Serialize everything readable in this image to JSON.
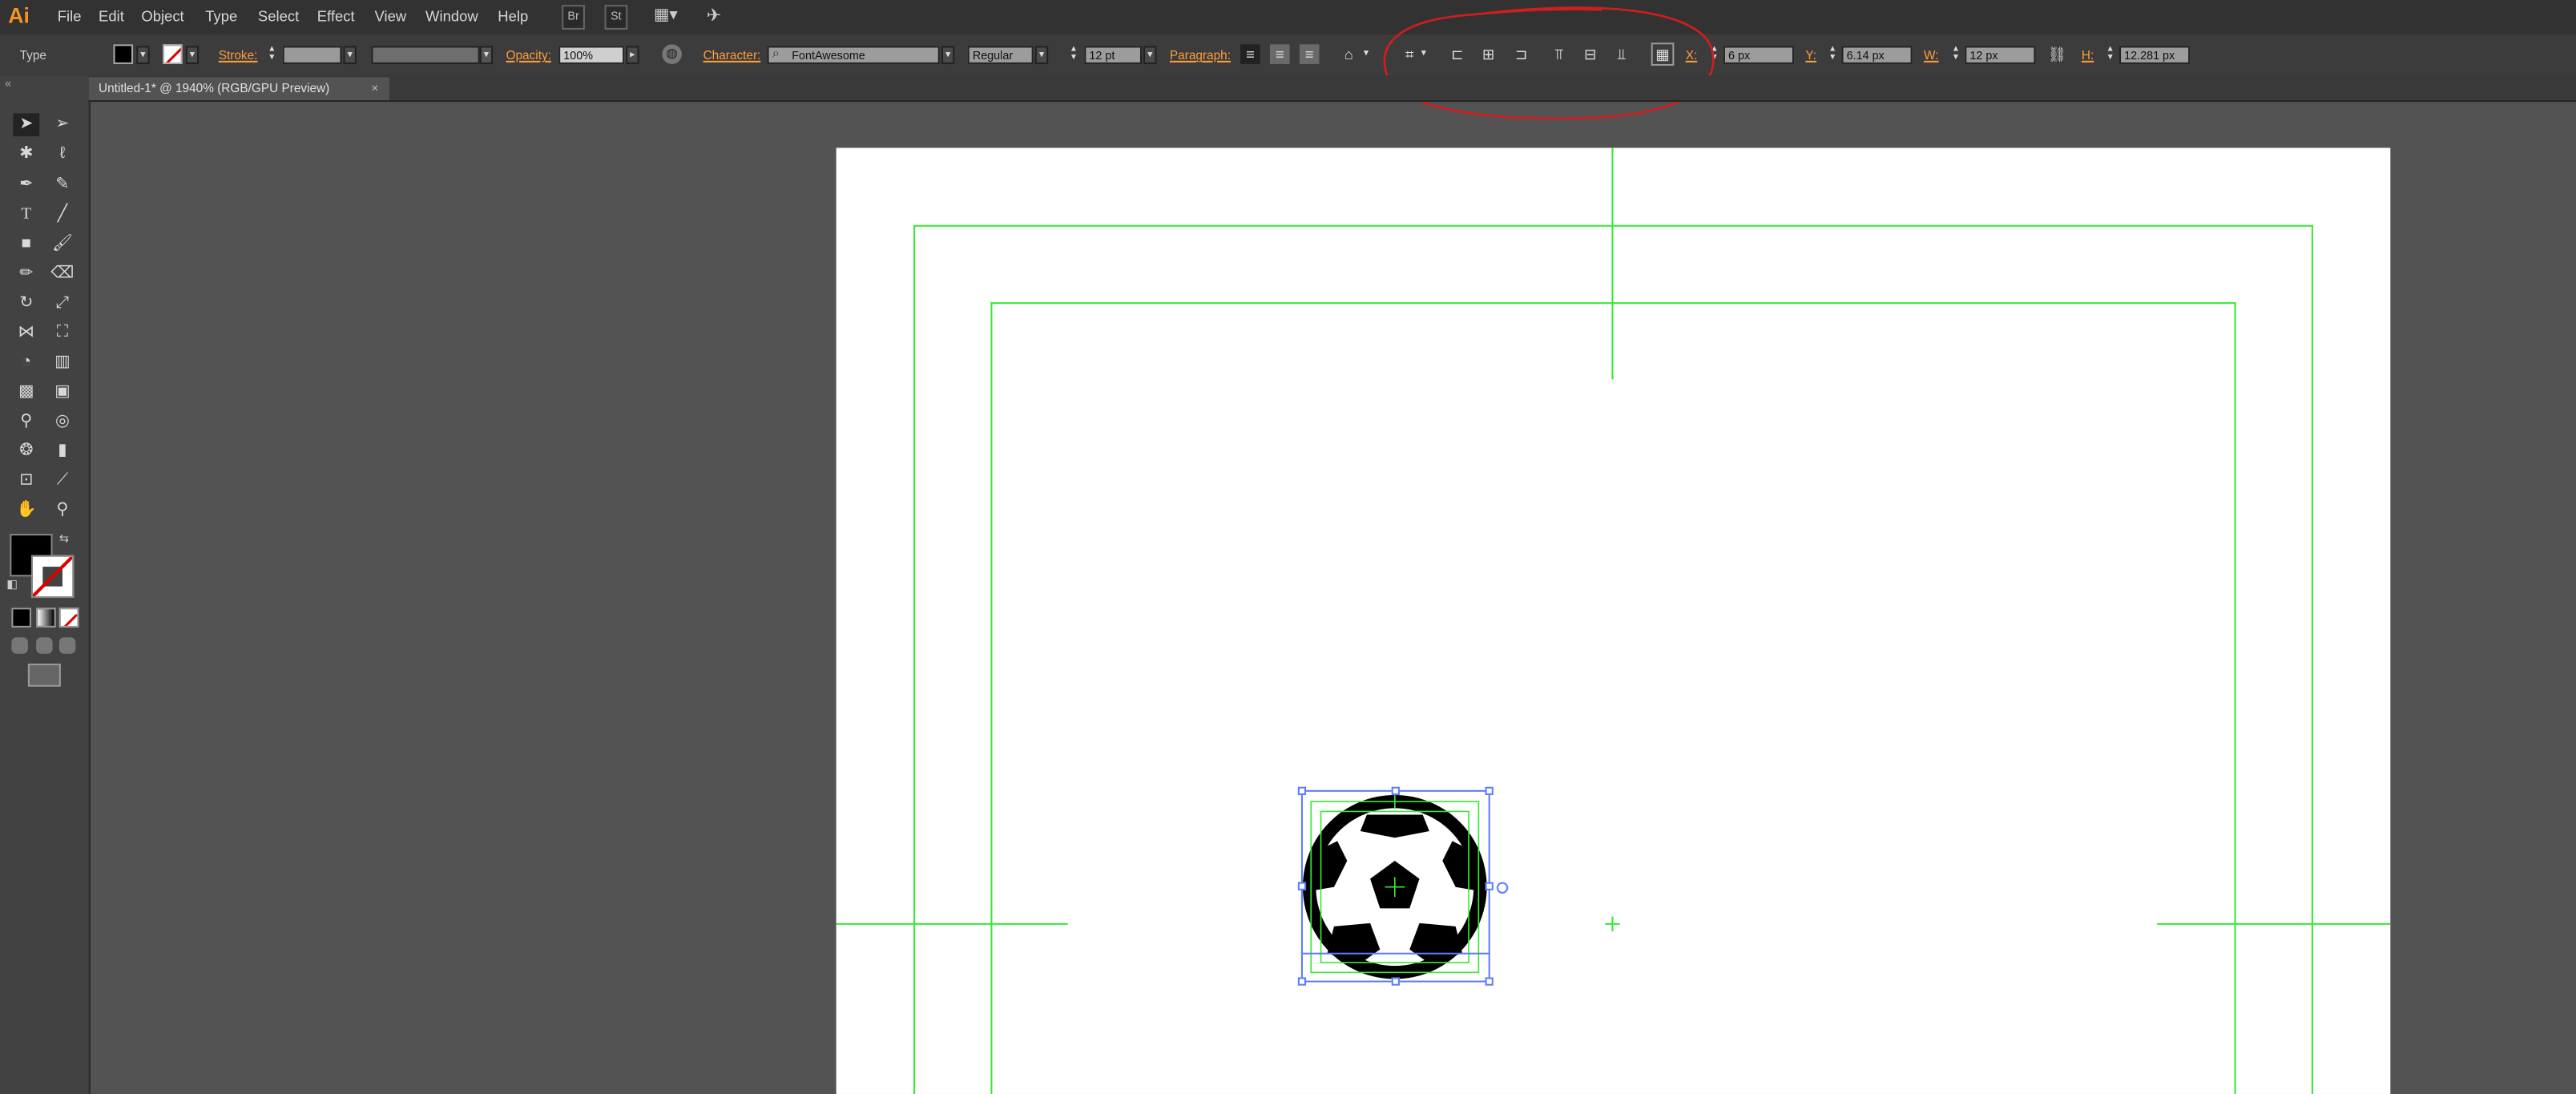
{
  "app": {
    "logo": "Ai"
  },
  "menu": [
    "File",
    "Edit",
    "Object",
    "Type",
    "Select",
    "Effect",
    "View",
    "Window",
    "Help"
  ],
  "menu_buttons": {
    "br": "Br",
    "st": "St"
  },
  "control": {
    "mode": "Type",
    "stroke_label": "Stroke:",
    "opacity_label": "Opacity:",
    "opacity_value": "100%",
    "character_label": "Character:",
    "font_value": "FontAwesome",
    "style_value": "Regular",
    "size_value": "12 pt",
    "paragraph_label": "Paragraph:",
    "x_label": "X:",
    "x_value": "6 px",
    "y_label": "Y:",
    "y_value": "6.14 px",
    "w_label": "W:",
    "w_value": "12 px",
    "h_label": "H:",
    "h_value": "12.281 px"
  },
  "document_tab": {
    "title": "Untitled-1* @ 1940% (RGB/GPU Preview)",
    "close": "×"
  },
  "colors": {
    "annotation": "#d01e1e",
    "guide": "#38e838",
    "selection": "#5b7bff",
    "accent": "#ff9e3d"
  }
}
